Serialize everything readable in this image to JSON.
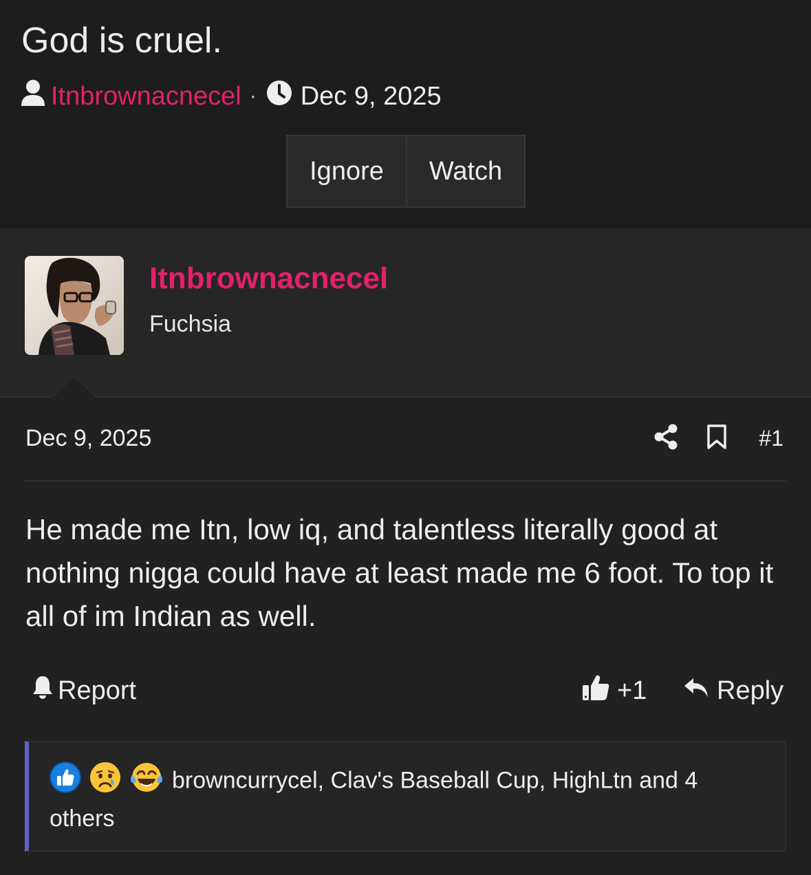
{
  "thread": {
    "title": "God is cruel.",
    "author": "Itnbrownacnecel",
    "separator": "·",
    "date": "Dec 9, 2025",
    "buttons": {
      "ignore": "Ignore",
      "watch": "Watch"
    }
  },
  "post": {
    "username": "Itnbrownacnecel",
    "user_title": "Fuchsia",
    "date": "Dec 9, 2025",
    "number": "#1",
    "body": "He made me Itn, low iq, and talentless literally good at nothing nigga could have at least made me 6 foot. To top it all of im Indian as well.",
    "actions": {
      "report": "Report",
      "like": "+1",
      "reply": "Reply"
    },
    "reactions": {
      "icons": [
        "thumbs-up-icon",
        "crying-face-icon",
        "tears-of-joy-icon"
      ],
      "text": "browncurrycel, Clav's Baseball Cup, HighLtn and 4 others"
    }
  },
  "colors": {
    "accent": "#e3216b",
    "background": "#212121",
    "reaction_bar": "#5c63c4"
  }
}
